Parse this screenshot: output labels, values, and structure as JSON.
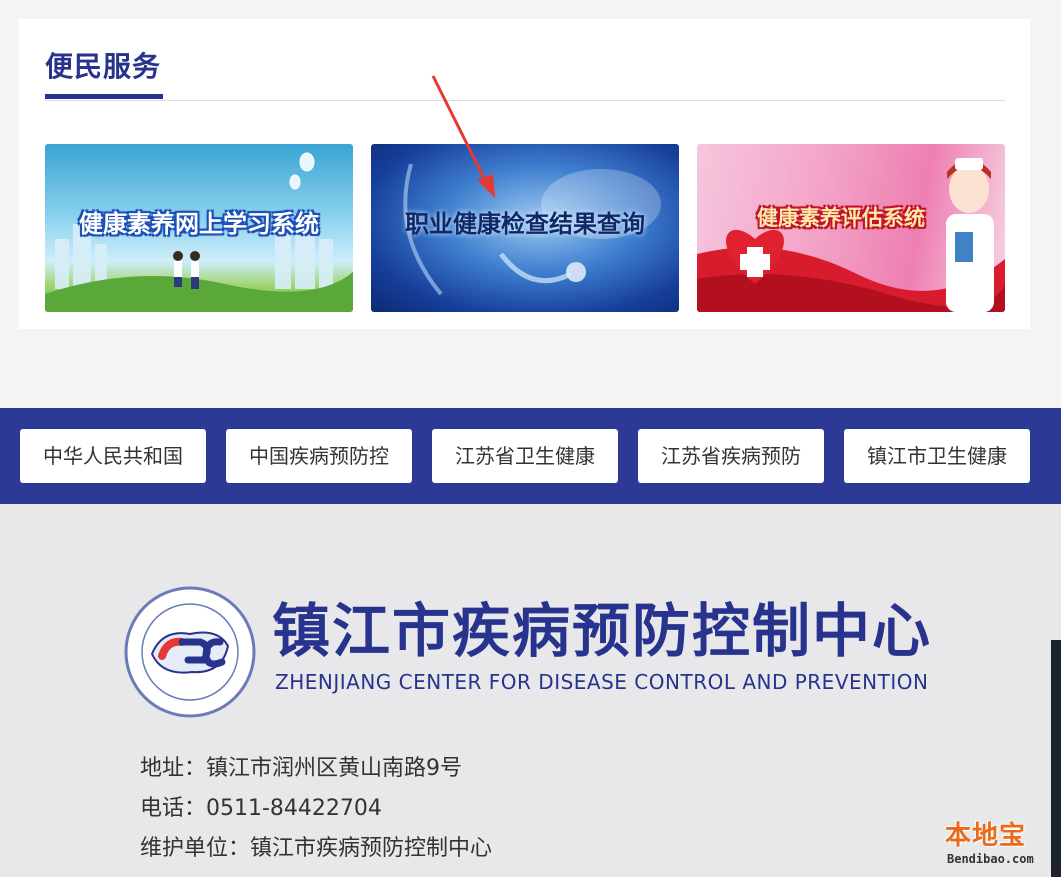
{
  "service": {
    "title": "便民服务",
    "banners": [
      {
        "label": "健康素养网上学习系统"
      },
      {
        "label": "职业健康检查结果查询"
      },
      {
        "label": "健康素养评估系统"
      }
    ]
  },
  "links": [
    {
      "label": "中华人民共和国"
    },
    {
      "label": "中国疾病预防控"
    },
    {
      "label": "江苏省卫生健康"
    },
    {
      "label": "江苏省疾病预防"
    },
    {
      "label": "镇江市卫生健康"
    }
  ],
  "footer": {
    "org_name_cn": "镇江市疾病预防控制中心",
    "org_name_en": "ZHENJIANG CENTER FOR DISEASE CONTROL AND PREVENTION",
    "address": "地址：镇江市润州区黄山南路9号",
    "phone": "电话：0511-84422704",
    "maintainer": "维护单位：镇江市疾病预防控制中心"
  },
  "watermark": {
    "name": "本地宝",
    "url": "Bendibao.com"
  },
  "colors": {
    "brand": "#27338d",
    "links_bar": "#2c3a95",
    "arrow": "#e53935"
  }
}
